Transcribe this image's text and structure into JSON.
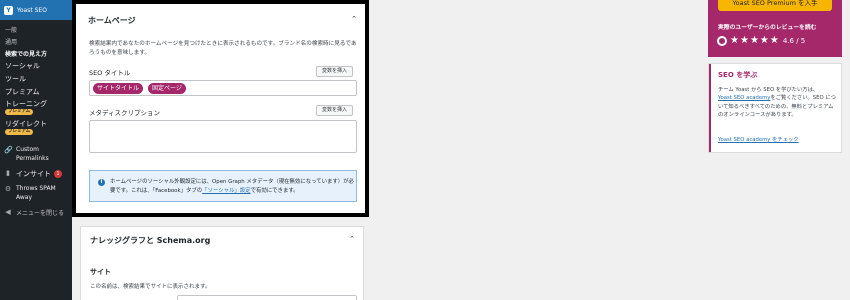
{
  "sidebar": {
    "header": "Yoast SEO",
    "items": [
      {
        "label": "一般",
        "current": false
      },
      {
        "label": "通用",
        "current": false
      },
      {
        "label": "検索での見え方",
        "current": true
      },
      {
        "label": "ソーシャル",
        "current": false
      },
      {
        "label": "ツール",
        "current": false
      },
      {
        "label": "プレミアム",
        "current": false
      },
      {
        "label": "トレーニング",
        "current": false,
        "badge": "プレミアム"
      },
      {
        "label": "リダイレクト",
        "current": false,
        "badge": "プレミアム"
      }
    ],
    "custom_permalinks_1": "Custom",
    "custom_permalinks_2": "Permalinks",
    "insight_label": "インサイト",
    "insight_count": "1",
    "throws_spam_1": "Throws SPAM",
    "throws_spam_2": "Away",
    "collapse_label": "メニューを閉じる"
  },
  "homepage": {
    "title": "ホームページ",
    "description": "検索結果内であなたのホームページを見つけたときに表示されるものです。ブランド名の検索時に見るであろうものを意味します。",
    "seo_title_label": "SEO タイトル",
    "insert_variable": "変数を挿入",
    "seo_title_pills": [
      "サイトタイトル",
      "固定ページ"
    ],
    "meta_label": "メタディスクリプション",
    "insert_variable_2": "変数を挿入",
    "notice_prefix": "ホームページのソーシャル外観設定には、Open Graph メタデータ（現在無効になっています）が必要です。これは、「Facebook」タブの",
    "notice_link": "「ソーシャル」設定",
    "notice_suffix": "で有効にできます。"
  },
  "knowledge_graph": {
    "title": "ナレッジグラフと Schema.org",
    "subtitle": "サイト",
    "description": "この名前は、検索結果でサイトに表示されます。"
  },
  "right": {
    "premium_button": "Yoast SEO Premium を入手",
    "review_text": "実際のユーザーからのレビューを読む",
    "rating": "4.6 / 5",
    "learn_title": "SEO を学ぶ",
    "learn_text_1": "チーム Yoast から SEO を学びたい方は、",
    "learn_link": "Yoast SEO academy",
    "learn_text_2": "をご覧ください。SEO について知るべきすべてのための、無料とプレミアムのオンラインコースがあります。",
    "learn_cta": "Yoast SEO academy をチェック"
  },
  "colors": {
    "sidebar_bg": "#1d2327",
    "accent_blue": "#2271b1",
    "yoast_purple": "#a4286a",
    "premium_yellow": "#f7b500"
  }
}
